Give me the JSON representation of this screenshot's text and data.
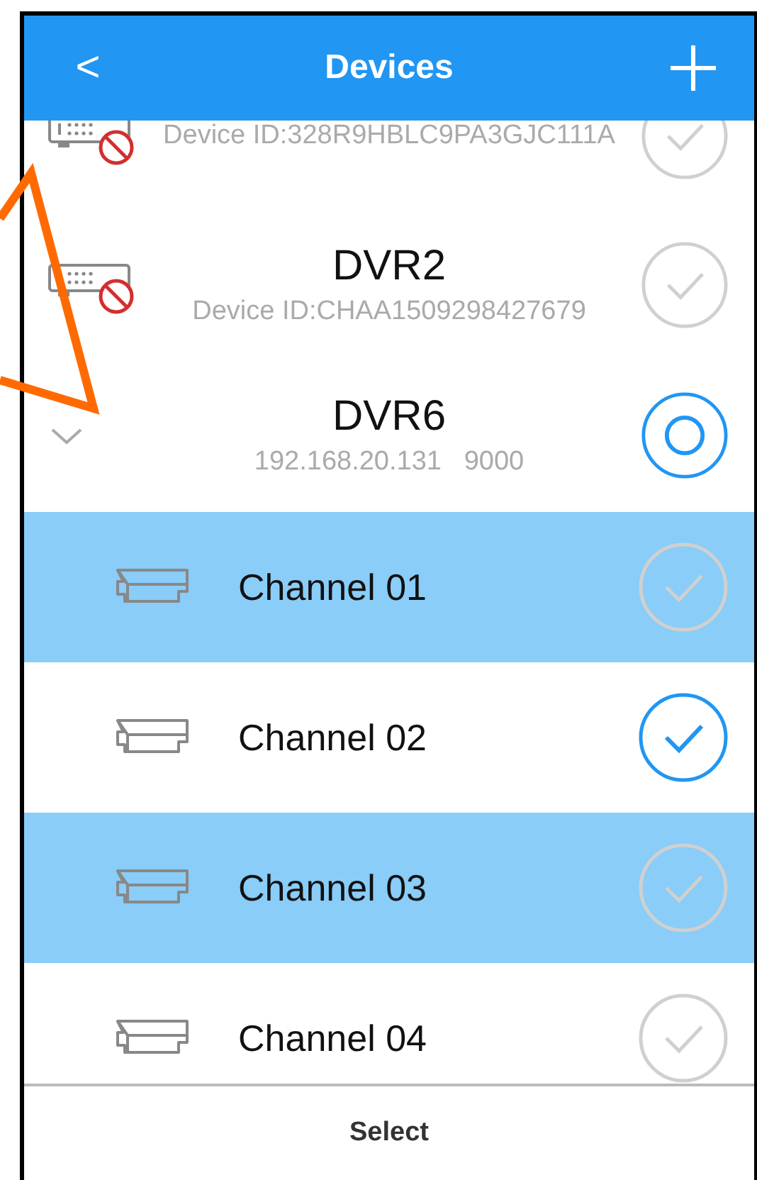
{
  "header": {
    "back_label": "<",
    "title": "Devices"
  },
  "devices": [
    {
      "id_text": "Device ID:328R9HBLC9PA3GJC111A",
      "offline": true,
      "expanded": false,
      "checked": false,
      "partial": false
    },
    {
      "name": "DVR2",
      "id_text": "Device ID:CHAA1509298427679",
      "offline": true,
      "expanded": false,
      "checked": false,
      "partial": false
    },
    {
      "name": "DVR6",
      "id_text": "192.168.20.131   9000",
      "offline": false,
      "expanded": true,
      "checked": false,
      "partial": true,
      "channels": [
        {
          "name": "Channel 01",
          "checked": false,
          "highlighted": true
        },
        {
          "name": "Channel 02",
          "checked": true,
          "highlighted": false
        },
        {
          "name": "Channel 03",
          "checked": false,
          "highlighted": true
        },
        {
          "name": "Channel 04",
          "checked": false,
          "highlighted": false
        }
      ]
    }
  ],
  "footer": {
    "button": "Select"
  }
}
